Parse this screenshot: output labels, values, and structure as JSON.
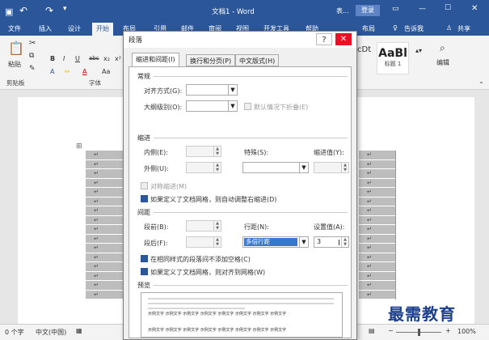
{
  "titlebar": {
    "title": "文档1 - Word",
    "qa_undo": "↶",
    "qa_redo": "↷",
    "save_icon": "save-icon",
    "user_partial": "表...",
    "login": "登录",
    "min": "—",
    "max": "☐",
    "close": "✕"
  },
  "tabs": [
    "文件",
    "插入",
    "设计",
    "开始",
    "布局",
    "引用",
    "邮件",
    "审阅",
    "视图",
    "开发工具",
    "帮助"
  ],
  "right_tabs": {
    "layout": "布局",
    "tell": "告诉我",
    "share": "共享"
  },
  "ribbon": {
    "paste": "粘贴",
    "clipboard": "剪贴板",
    "font_group": "字体",
    "bold": "B",
    "italic": "I",
    "underline": "U",
    "strike": "abc",
    "sub": "x₂",
    "sup": "x²",
    "font_a": "A",
    "aa": "Aa",
    "style_partial": "cDt",
    "style_big": "AaBl",
    "style_label": "标题 1",
    "edit": "编辑"
  },
  "dialog": {
    "title": "段落",
    "help": "?",
    "close": "✕",
    "tabs": [
      "缩进和间距(I)",
      "换行和分页(P)",
      "中文版式(H)"
    ],
    "general": {
      "header": "常规",
      "align_label": "对齐方式(G):",
      "outline_label": "大纲级别(O):",
      "collapse_label": "默认情况下折叠(E)"
    },
    "indent": {
      "header": "缩进",
      "inner_label": "内侧(E):",
      "outer_label": "外侧(U):",
      "special_label": "特殊(S):",
      "indent_value_label": "缩进值(Y):",
      "mirror_label": "对称缩进(M)",
      "auto_label": "如果定义了文档网格，则自动调整右缩进(D)"
    },
    "spacing": {
      "header": "间距",
      "before_label": "段前(B):",
      "after_label": "段后(F):",
      "line_label": "行距(N):",
      "set_label": "设置值(A):",
      "line_value": "多倍行距",
      "set_value": "3",
      "no_space_label": "在相同样式的段落间不添加空格(C)",
      "snap_label": "如果定义了文档网格，则对齐到网格(W)"
    },
    "preview": {
      "header": "预览",
      "sample_text": "示例文字 示例文字 示例文字 示例文字 示例文字 示例文字 示例文字 示例文字"
    }
  },
  "status": {
    "words": "0 个字",
    "lang": "中文(中国)",
    "zoom": "100%",
    "plus": "+",
    "minus": "−"
  },
  "watermark": "最需教育"
}
